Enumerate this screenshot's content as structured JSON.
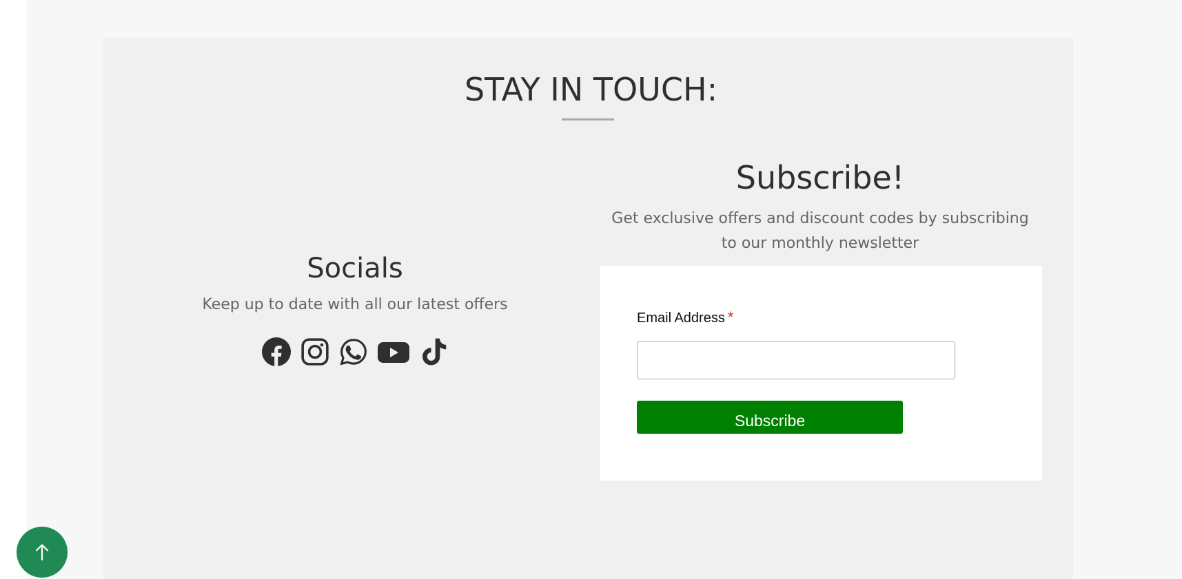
{
  "main": {
    "title": "STAY IN TOUCH:"
  },
  "socials": {
    "title": "Socials",
    "description": "Keep up to date with all our latest offers",
    "icons": [
      "facebook-icon",
      "instagram-icon",
      "whatsapp-icon",
      "youtube-icon",
      "tiktok-icon"
    ]
  },
  "subscribe": {
    "title": "Subscribe!",
    "description": "Get exclusive offers and discount codes by subscribing to our monthly newsletter",
    "email_label": "Email Address",
    "required_marker": "*",
    "email_value": "",
    "email_placeholder": "",
    "button_label": "Subscribe"
  },
  "back_to_top": {
    "icon": "arrow-up-icon"
  },
  "colors": {
    "page_bg": "#f7f7f7",
    "section_bg": "#f0f0f0",
    "heading": "#2f2f2f",
    "subtext": "#666666",
    "subscribe_button": "#008000",
    "back_to_top": "#1f8a53",
    "required": "#c0392b",
    "icons": "#2f2f2f"
  }
}
